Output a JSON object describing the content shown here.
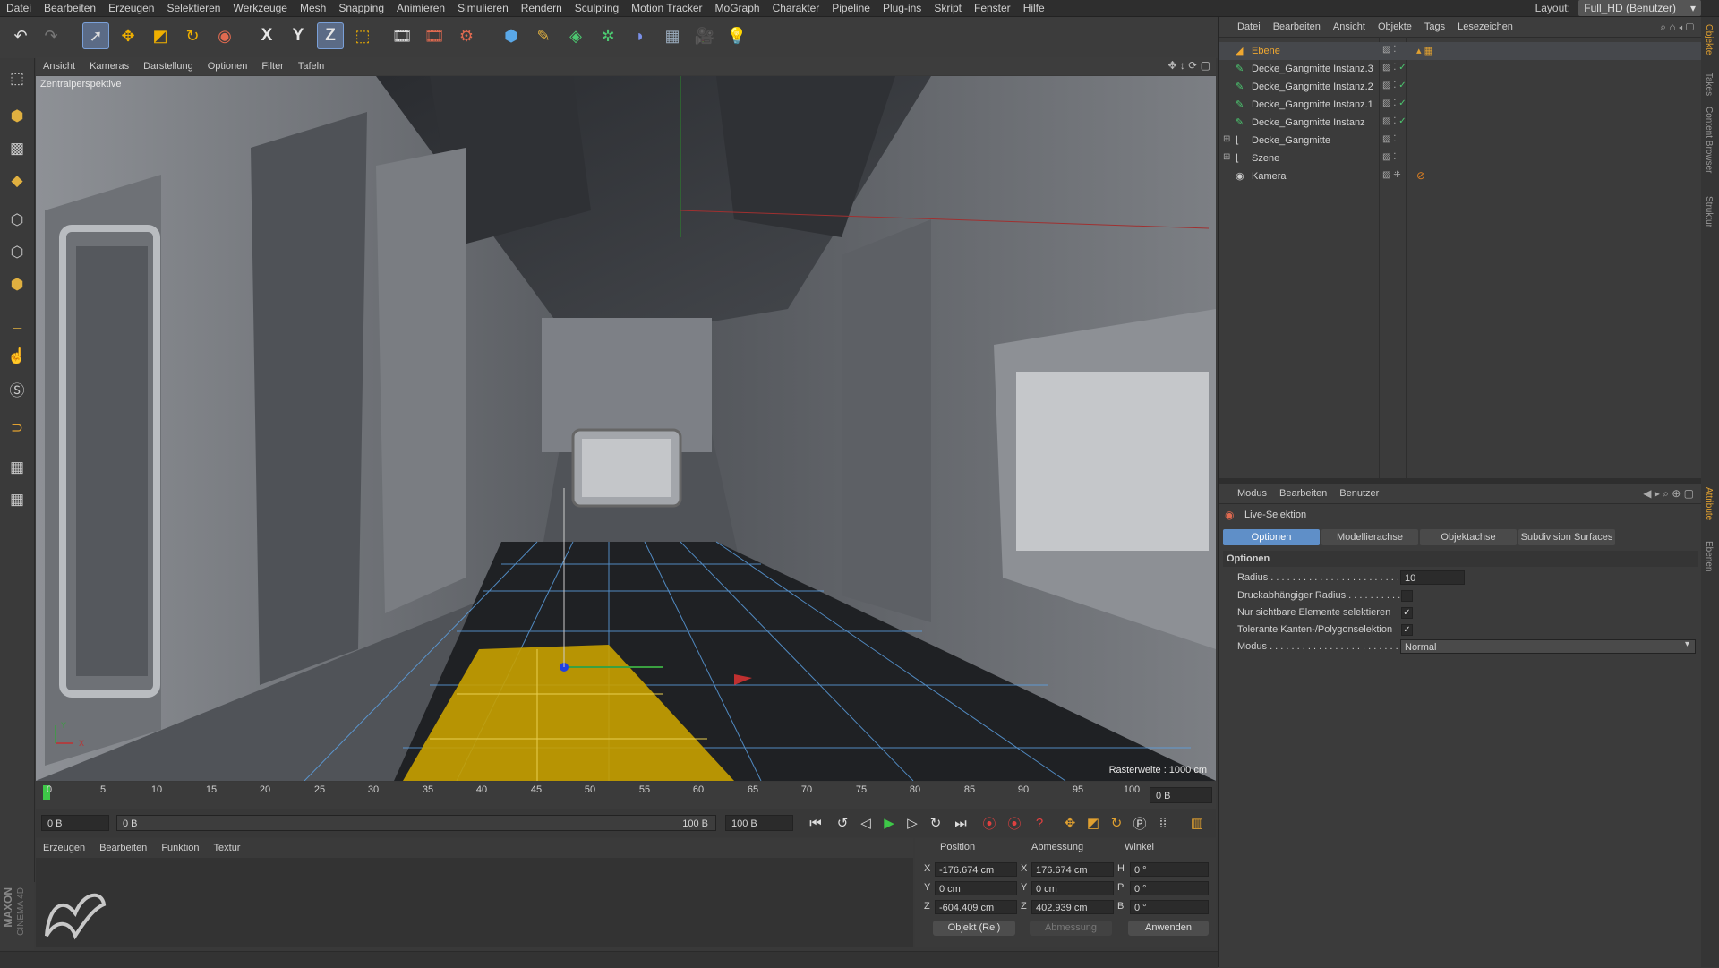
{
  "menubar": {
    "items": [
      "Datei",
      "Bearbeiten",
      "Erzeugen",
      "Selektieren",
      "Werkzeuge",
      "Mesh",
      "Snapping",
      "Animieren",
      "Simulieren",
      "Rendern",
      "Sculpting",
      "Motion Tracker",
      "MoGraph",
      "Charakter",
      "Pipeline",
      "Plug-ins",
      "Skript",
      "Fenster",
      "Hilfe"
    ],
    "layout_label": "Layout:",
    "layout_value": "Full_HD (Benutzer)"
  },
  "toolbar": {
    "axis_x": "X",
    "axis_y": "Y",
    "axis_z": "Z"
  },
  "viewport": {
    "menu": [
      "Ansicht",
      "Kameras",
      "Darstellung",
      "Optionen",
      "Filter",
      "Tafeln"
    ],
    "camera_label": "Zentralperspektive",
    "grid_label": "Rasterweite : 1000 cm",
    "axis_y_label": "Y",
    "axis_x_label": "X"
  },
  "timeline": {
    "ticks": [
      "0",
      "5",
      "10",
      "15",
      "20",
      "25",
      "30",
      "35",
      "40",
      "45",
      "50",
      "55",
      "60",
      "65",
      "70",
      "75",
      "80",
      "85",
      "90",
      "95",
      "100"
    ],
    "current_frame": "0 B",
    "start_field": "0 B",
    "range_start": "0 B",
    "range_end": "100 B",
    "end_field": "100 B"
  },
  "material_manager": {
    "menu": [
      "Erzeugen",
      "Bearbeiten",
      "Funktion",
      "Textur"
    ]
  },
  "coordinates": {
    "headers": [
      "Position",
      "Abmessung",
      "Winkel"
    ],
    "rows": [
      {
        "pos_label": "X",
        "pos": "-176.674 cm",
        "size_label": "X",
        "size": "176.674 cm",
        "rot_label": "H",
        "rot": "0 °"
      },
      {
        "pos_label": "Y",
        "pos": "0 cm",
        "size_label": "Y",
        "size": "0 cm",
        "rot_label": "P",
        "rot": "0 °"
      },
      {
        "pos_label": "Z",
        "pos": "-604.409 cm",
        "size_label": "Z",
        "size": "402.939 cm",
        "rot_label": "B",
        "rot": "0 °"
      }
    ],
    "mode": "Objekt (Rel)",
    "size_mode": "Abmessung",
    "apply": "Anwenden"
  },
  "object_manager": {
    "menu": [
      "Datei",
      "Bearbeiten",
      "Ansicht",
      "Objekte",
      "Tags",
      "Lesezeichen"
    ],
    "objects": [
      {
        "name": "Ebene",
        "selected": true
      },
      {
        "name": "Decke_Gangmitte Instanz.3"
      },
      {
        "name": "Decke_Gangmitte Instanz.2"
      },
      {
        "name": "Decke_Gangmitte Instanz.1"
      },
      {
        "name": "Decke_Gangmitte Instanz"
      },
      {
        "name": "Decke_Gangmitte"
      },
      {
        "name": "Szene"
      },
      {
        "name": "Kamera"
      }
    ]
  },
  "attribute_manager": {
    "menu": [
      "Modus",
      "Bearbeiten",
      "Benutzer"
    ],
    "tool_name": "Live-Selektion",
    "tabs": [
      "Optionen",
      "Modellierachse",
      "Objektachse",
      "Subdivision Surfaces"
    ],
    "section": "Optionen",
    "params": [
      {
        "label": "Radius . . . . . . . . . . . . . . . . . . . . . . . . .",
        "value": "10"
      },
      {
        "label": "Druckabhängiger Radius . . . . . . . . . .",
        "checked": false
      },
      {
        "label": "Nur sichtbare Elemente selektieren",
        "checked": true
      },
      {
        "label": "Tolerante Kanten-/Polygonselektion",
        "checked": true
      },
      {
        "label": "Modus . . . . . . . . . . . . . . . . . . . . . . . . . .",
        "value": "Normal"
      }
    ]
  },
  "right_strip": [
    "Objekte",
    "Takes",
    "Content Browser",
    "Struktur",
    "Attribute",
    "Ebenen"
  ],
  "logo": {
    "brand": "MAXON",
    "product": "CINEMA 4D"
  },
  "colors": {
    "accent": "#5f8fc8",
    "selection": "#c8a100",
    "object_active": "#f0a830"
  }
}
